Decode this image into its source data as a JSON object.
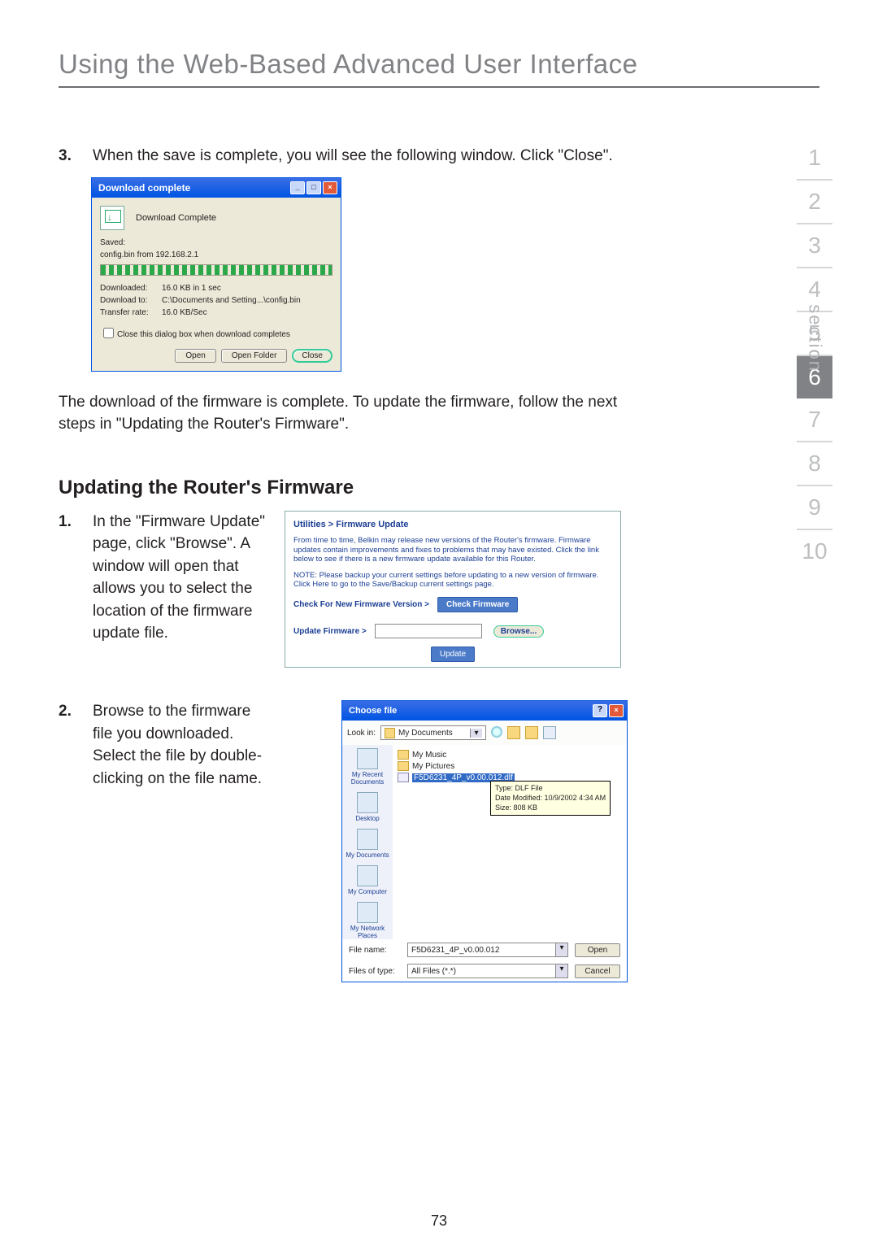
{
  "title": "Using the Web-Based Advanced User Interface",
  "nav": {
    "label": "section",
    "items": [
      "1",
      "2",
      "3",
      "4",
      "5",
      "6",
      "7",
      "8",
      "9",
      "10"
    ],
    "active": "6"
  },
  "step3": {
    "num": "3.",
    "text": "When the save is complete, you will see the following window. Click \"Close\"."
  },
  "download_dialog": {
    "title": "Download complete",
    "header": "Download Complete",
    "saved_label": "Saved:",
    "saved_file": "config.bin from 192.168.2.1",
    "rows": {
      "downloaded_k": "Downloaded:",
      "downloaded_v": "16.0 KB in 1 sec",
      "to_k": "Download to:",
      "to_v": "C:\\Documents and Setting...\\config.bin",
      "rate_k": "Transfer rate:",
      "rate_v": "16.0 KB/Sec"
    },
    "checkbox": "Close this dialog box when download completes",
    "buttons": {
      "open": "Open",
      "open_folder": "Open Folder",
      "close": "Close"
    }
  },
  "para_after": "The download of the firmware is complete. To update the firmware, follow the next steps in \"Updating the Router's Firmware\".",
  "subhead": "Updating the Router's Firmware",
  "step1": {
    "num": "1.",
    "text": "In the \"Firmware Update\" page, click \"Browse\". A window will open that allows you to select the location of the firmware update file."
  },
  "fw_panel": {
    "crumb": "Utilities > Firmware Update",
    "p1": "From time to time, Belkin may release new versions of the Router's firmware. Firmware updates contain improvements and fixes to problems that may have existed. Click the link below to see if there is a new firmware update available for this Router.",
    "p2": "NOTE: Please backup your current settings before updating to a new version of firmware. Click Here to go to the Save/Backup current settings page.",
    "check_label": "Check For New Firmware Version >",
    "check_btn": "Check Firmware",
    "update_label": "Update Firmware >",
    "browse_btn": "Browse...",
    "update_btn": "Update"
  },
  "step2": {
    "num": "2.",
    "text": "Browse to the firmware file you downloaded. Select the file by double-clicking on the file name."
  },
  "choose": {
    "title": "Choose file",
    "lookin": "Look in:",
    "folder": "My Documents",
    "places": [
      "My Recent Documents",
      "Desktop",
      "My Documents",
      "My Computer",
      "My Network Places"
    ],
    "files": {
      "f1": "My Music",
      "f2": "My Pictures",
      "sel": "F5D6231_4P_v0.00.012.dlf"
    },
    "tooltip": {
      "l1": "Type: DLF File",
      "l2": "Date Modified: 10/9/2002 4:34 AM",
      "l3": "Size: 808 KB"
    },
    "fname_l": "File name:",
    "fname_v": "F5D6231_4P_v0.00.012",
    "ftype_l": "Files of type:",
    "ftype_v": "All Files (*.*)",
    "open": "Open",
    "cancel": "Cancel"
  },
  "page_number": "73"
}
